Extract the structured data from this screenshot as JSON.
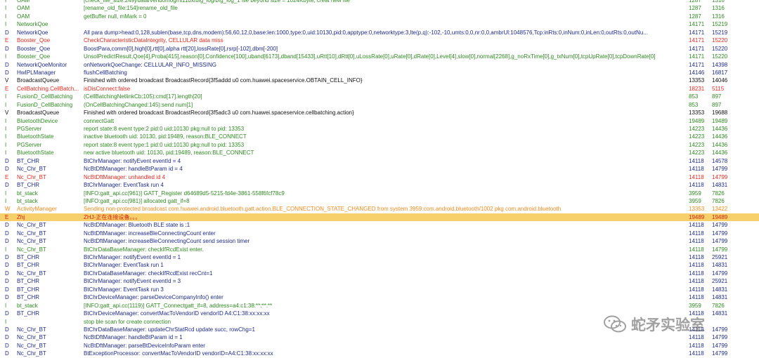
{
  "colors": {
    "debug": "#1f2a8c",
    "verbose": "#111111",
    "info": "#2f8a21",
    "error": "#e8291f",
    "warn": "#f08a1a",
    "highlight_row": "#f8d06b"
  },
  "rows": [
    {
      "level": "I",
      "tag": "OAM",
      "msg": "[check_file_size:249]/data/vendor/log/hi110x/bfg_log/bfg_log_1 file beyond size = 1024Kbyte, creat new file",
      "pid": "1287",
      "tid": "1316"
    },
    {
      "level": "I",
      "tag": "OAM",
      "msg": "[rename_old_file:154]rename_old_file",
      "pid": "1287",
      "tid": "1316"
    },
    {
      "level": "I",
      "tag": "OAM",
      "msg": "getBuffer null, mMark = 0",
      "pid": "1287",
      "tid": "1316"
    },
    {
      "level": "I",
      "tag": "NetworkQoe",
      "msg": "",
      "pid": "14171",
      "tid": "15219"
    },
    {
      "level": "D",
      "tag": "NetworkQoe",
      "msg": "All para dump>head:0,128,sublen(base,tcp,dns,modem):56,60,12,0,base:len:1000,type:0,uid:10130,pid:0,apptype:0,networktype:3,lte(p,q):-102,-10,umts:0,0,nr:0,0,ambrUl:1048576,Tcp:inRts:0,inNum:0,inLen:0,outRts:0,outNu...",
      "pid": "14171",
      "tid": "15219"
    },
    {
      "level": "E",
      "tag": "Booster_Qoe",
      "msg": "CheckCharacteristicDataIntegrity, CELLULAR data miss",
      "pid": "14171",
      "tid": "15220"
    },
    {
      "level": "D",
      "tag": "Booster_Qoe",
      "msg": "BoostPara,comm[0],high[0],rtt[0],alpha rtt[20],lossRate[0],rsrp[-102],dbm[-200]",
      "pid": "14171",
      "tid": "15220"
    },
    {
      "level": "I",
      "tag": "Booster_Qoe",
      "msg": "UnsolPredictResult,Qoe[4],Proba[415],reason[0],Confidence[100],uband[6173],dband[15433],uRtt[10],dRtt[0],uLossRate[0],uRate[0],dRate[0],Level[4],slow[0],normal[2268],g_noRxTime[0],g_txNum[0],tcpUpRate[0],tcpDownRate[0]",
      "pid": "14171",
      "tid": "15220"
    },
    {
      "level": "D",
      "tag": "NetworkQoeMonitor",
      "msg": "onNetworkQoeChange: CELLULAR_INFO_MISSING",
      "pid": "14171",
      "tid": "14398"
    },
    {
      "level": "D",
      "tag": "HwIPLManager",
      "msg": "flushCellBatching",
      "pid": "14146",
      "tid": "16817"
    },
    {
      "level": "V",
      "tag": "BroadcastQueue",
      "msg": "Finished with ordered broadcast BroadcastRecord{3f5addd u0 com.huawei.spaceservice.OBTAIN_CELL_INFO}",
      "pid": "13353",
      "tid": "14046"
    },
    {
      "level": "E",
      "tag": "CellBatching.CellBatch...",
      "msg": "isDisConnect:false",
      "pid": "18231",
      "tid": "5115"
    },
    {
      "level": "I",
      "tag": "FusionD_CellBatching",
      "msg": "(CellBatchingNetlinkCb:105):cmd[17].length[20]",
      "pid": "853",
      "tid": "897"
    },
    {
      "level": "I",
      "tag": "FusionD_CellBatching",
      "msg": "(OnCellBatchingChanged:145):send num[1]",
      "pid": "853",
      "tid": "897"
    },
    {
      "level": "V",
      "tag": "BroadcastQueue",
      "msg": "Finished with ordered broadcast BroadcastRecord{3f5adc3 u0 com.huawei.spaceservice.cellbatching.action}",
      "pid": "13353",
      "tid": "19688"
    },
    {
      "level": "I",
      "tag": "BluetoothDevice",
      "msg": "connectGatt",
      "pid": "19489",
      "tid": "19489"
    },
    {
      "level": "I",
      "tag": "PGServer",
      "msg": "report state:8 event type:2 pid:0 uid:10130 pkg:null to pid: 13353",
      "pid": "14223",
      "tid": "14436"
    },
    {
      "level": "I",
      "tag": "BluetoothState",
      "msg": "inactive bluetooth uid: 10130, pid:19489, reason:BLE_CONNECT",
      "pid": "14223",
      "tid": "14436"
    },
    {
      "level": "I",
      "tag": "PGServer",
      "msg": "report state:8 event type:1 pid:0 uid:10130 pkg:null to pid: 13353",
      "pid": "14223",
      "tid": "14436"
    },
    {
      "level": "I",
      "tag": "BluetoothState",
      "msg": "new active bluetooth uid: 10130, pid:19489, reason:BLE_CONNECT",
      "pid": "14223",
      "tid": "14436"
    },
    {
      "level": "D",
      "tag": "BT_CHR",
      "msg": "BtChrManager: notifyEvent eventId = 4",
      "pid": "14118",
      "tid": "14578"
    },
    {
      "level": "D",
      "tag": "Nc_Chr_BT",
      "msg": "NcBtDftManager: handleBtParam id = 4",
      "pid": "14118",
      "tid": "14799"
    },
    {
      "level": "E",
      "tag": "Nc_Chr_BT",
      "msg": "NcBtDftManager: unhandled id 4",
      "pid": "14118",
      "tid": "14799"
    },
    {
      "level": "D",
      "tag": "BT_CHR",
      "msg": "BtChrManager: EventTask run 4",
      "pid": "14118",
      "tid": "14831"
    },
    {
      "level": "I",
      "tag": "bt_stack",
      "msg": "[INFO:gatt_api.cc(961)] GATT_Register d64689d5-5215-fd4e-3861-558f6fcf78c9",
      "pid": "3959",
      "tid": "7826"
    },
    {
      "level": "I",
      "tag": "bt_stack",
      "msg": "[INFO:gatt_api.cc(981)] allocated gatt_if=8",
      "pid": "3959",
      "tid": "7826"
    },
    {
      "level": "W",
      "tag": "ActivityManager",
      "msg": "Sending non-protected broadcast com.huawei.android.bluetooth.gatt.action.BLE_CONNECTION_STATE_CHANGED from system 3959:com.android.bluetooth/1002 pkg com.android.bluetooth",
      "pid": "13353",
      "tid": "13422"
    },
    {
      "level": "E",
      "tag": "Zhj",
      "msg": "ZHJ-正在连接设备。。。",
      "pid": "19489",
      "tid": "19489",
      "highlight": true
    },
    {
      "level": "D",
      "tag": "Nc_Chr_BT",
      "msg": "NcBtDftManager: Bluetooth BLE state is :1",
      "pid": "14118",
      "tid": "14799"
    },
    {
      "level": "D",
      "tag": "Nc_Chr_BT",
      "msg": "NcBtDftManager: increaseBleConnectingCount enter",
      "pid": "14118",
      "tid": "14799"
    },
    {
      "level": "D",
      "tag": "Nc_Chr_BT",
      "msg": "NcBtDftManager: increaseBleConnectingCount send session timer",
      "pid": "14118",
      "tid": "14799"
    },
    {
      "level": "I",
      "tag": "Nc_Chr_BT",
      "msg": "BtChrDataBaseManager: checkIfRcdExist enter.",
      "pid": "14118",
      "tid": "14799"
    },
    {
      "level": "D",
      "tag": "BT_CHR",
      "msg": "BtChrManager: notifyEvent eventId = 1",
      "pid": "14118",
      "tid": "25921"
    },
    {
      "level": "D",
      "tag": "BT_CHR",
      "msg": "BtChrManager: EventTask run 1",
      "pid": "14118",
      "tid": "14831"
    },
    {
      "level": "D",
      "tag": "Nc_Chr_BT",
      "msg": "BtChrDataBaseManager: checkIfRcdExist recCnt=1",
      "pid": "14118",
      "tid": "14799"
    },
    {
      "level": "D",
      "tag": "BT_CHR",
      "msg": "BtChrManager: notifyEvent eventId = 3",
      "pid": "14118",
      "tid": "25921"
    },
    {
      "level": "D",
      "tag": "BT_CHR",
      "msg": "BtChrManager: EventTask run 3",
      "pid": "14118",
      "tid": "14831"
    },
    {
      "level": "D",
      "tag": "BT_CHR",
      "msg": "BtChrDeviceManager: parseDeviceCompanyInfo() enter",
      "pid": "14118",
      "tid": "14831"
    },
    {
      "level": "I",
      "tag": "bt_stack",
      "msg": "[INFO:gatt_api.cc(1119)] GATT_Connectgatt_if=8, address=a4:c1:38:**:**:**",
      "pid": "3959",
      "tid": "7826"
    },
    {
      "level": "D",
      "tag": "BT_CHR",
      "msg": "BtChrDeviceManager: convertMacToVendorID vendorID A4:C1:38:xx:xx:xx",
      "pid": "14118",
      "tid": "14831"
    },
    {
      "level": "I",
      "tag": "",
      "msg": "stop ble scan for create connection",
      "pid": "",
      "tid": ""
    },
    {
      "level": "D",
      "tag": "Nc_Chr_BT",
      "msg": "BtChrDataBaseManager: updateChrStatRcd update succ, rowChg=1",
      "pid": "14118",
      "tid": "14799"
    },
    {
      "level": "D",
      "tag": "Nc_Chr_BT",
      "msg": "NcBtDftManager: handleBtParam id = 1",
      "pid": "14118",
      "tid": "14799"
    },
    {
      "level": "D",
      "tag": "Nc_Chr_BT",
      "msg": "NcBtDftManager: parseBtDeviceInfoParam enter",
      "pid": "14118",
      "tid": "14799"
    },
    {
      "level": "D",
      "tag": "Nc_Chr_BT",
      "msg": "BtExceptionProcessor: convertMacToVendorID vendorID=A4:C1:38:xx:xx:xx",
      "pid": "14118",
      "tid": "14799"
    }
  ],
  "watermark": {
    "text": "蛇矛实验室"
  }
}
